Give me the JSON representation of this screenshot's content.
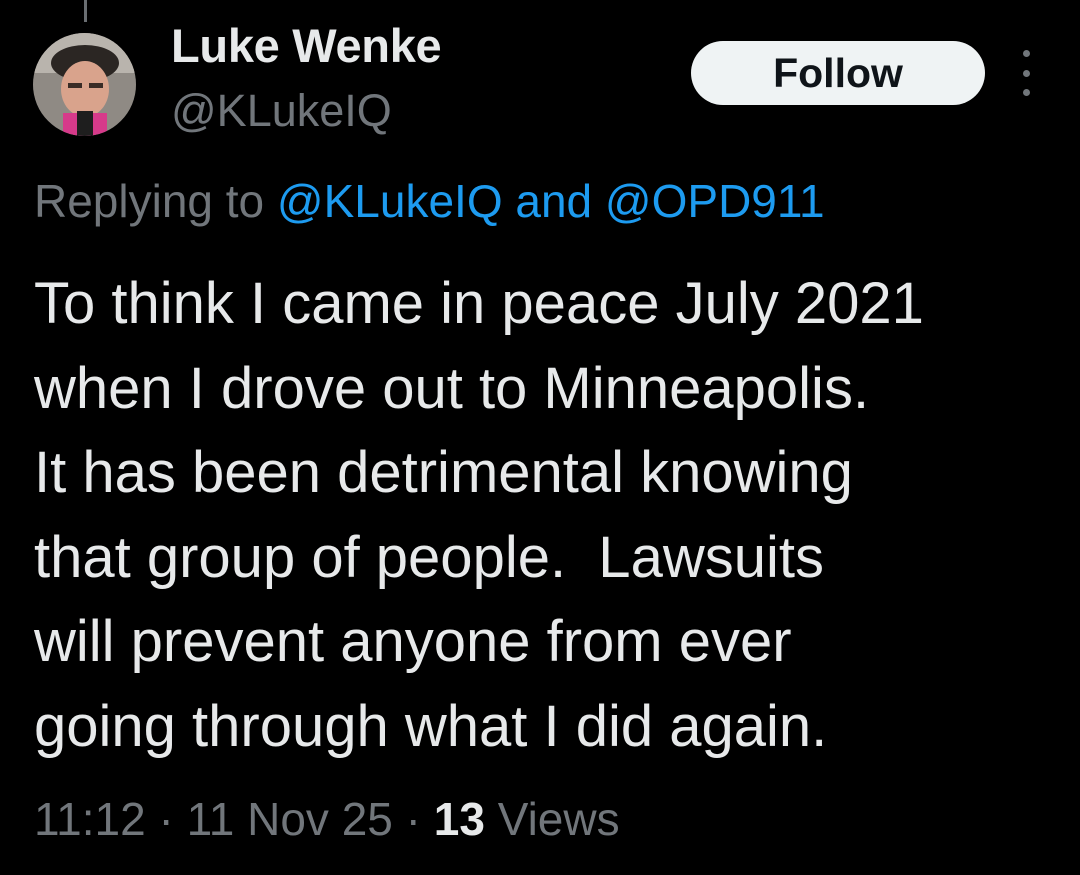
{
  "author": {
    "name": "Luke Wenke",
    "handle": "@KLukeIQ"
  },
  "actions": {
    "follow_label": "Follow",
    "more_icon": "more-vertical-icon"
  },
  "reply_context": {
    "prefix": "Replying to",
    "mention_1": "@KLukeIQ",
    "connector": "and",
    "mention_2": "@OPD911"
  },
  "tweet": {
    "text": "To think I came in peace July 2021\nwhen I drove out to Minneapolis.\nIt has been detrimental knowing\nthat group of people.  Lawsuits\nwill prevent anyone from ever\ngoing through what I did again."
  },
  "meta": {
    "time": "11:12",
    "separator": "·",
    "date": "11 Nov 25",
    "views_count": "13",
    "views_label": "Views"
  },
  "colors": {
    "background": "#000000",
    "text_primary": "#e7e9ea",
    "text_secondary": "#71767b",
    "link": "#1d9bf0",
    "follow_button_bg": "#eff3f4",
    "follow_button_text": "#0f1419"
  }
}
